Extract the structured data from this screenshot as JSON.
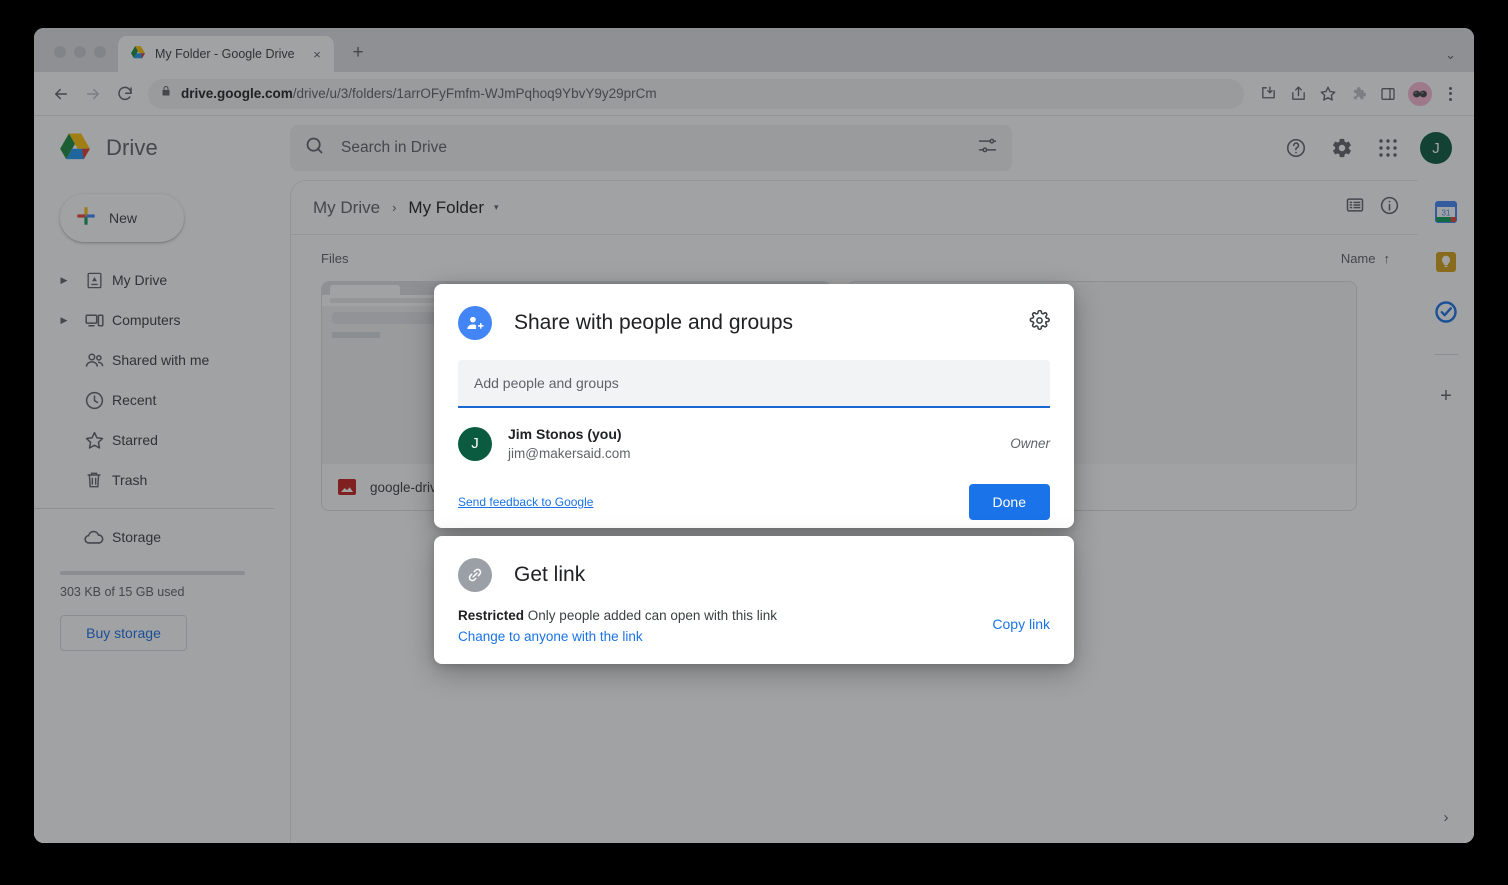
{
  "browser": {
    "tab": {
      "title": "My Folder - Google Drive",
      "favicon": "google-drive-icon",
      "close": "×"
    },
    "new_tab_label": "+",
    "tab_list_chevron": "⌄",
    "nav": {
      "back": "←",
      "forward": "→",
      "reload": "↻"
    },
    "omnibox": {
      "lock_icon": "lock-icon",
      "url_domain": "drive.google.com",
      "url_path": "/drive/u/3/folders/1arrOFyFmfm-WJmPqhoq9YbvY9y29prCm"
    },
    "toolbar_icons": [
      "download-icon",
      "share-icon",
      "bookmark-star-icon",
      "extensions-puzzle-icon",
      "side-panel-icon",
      "profile-avatar-icon",
      "chrome-menu-icon"
    ]
  },
  "drive": {
    "brand": "Drive",
    "search": {
      "placeholder": "Search in Drive",
      "icon": "search-icon",
      "options_icon": "search-options-icon"
    },
    "header_icons": [
      "help-icon",
      "settings-gear-icon",
      "apps-grid-icon"
    ],
    "account_initial": "J",
    "sidebar": {
      "new_button": "New",
      "items": [
        {
          "label": "My Drive",
          "icon": "my-drive-icon",
          "expandable": true
        },
        {
          "label": "Computers",
          "icon": "computers-icon",
          "expandable": true
        },
        {
          "label": "Shared with me",
          "icon": "shared-with-me-icon",
          "expandable": false
        },
        {
          "label": "Recent",
          "icon": "recent-clock-icon",
          "expandable": false
        },
        {
          "label": "Starred",
          "icon": "star-icon",
          "expandable": false
        },
        {
          "label": "Trash",
          "icon": "trash-icon",
          "expandable": false
        },
        {
          "label": "Storage",
          "icon": "cloud-storage-icon",
          "expandable": false
        }
      ],
      "storage_used": "303 KB of 15 GB used",
      "buy_storage": "Buy storage"
    },
    "breadcrumb": {
      "root": "My Drive",
      "separator": "›",
      "current": "My Folder",
      "caret": "▾"
    },
    "view_icons": [
      "list-view-icon",
      "details-info-icon"
    ],
    "files_section": {
      "label": "Files",
      "sort_by": "Name",
      "sort_arrow": "↑",
      "items": [
        {
          "name": "google-drive-",
          "icon": "image-file-icon"
        },
        {
          "name": "",
          "icon": "image-file-icon"
        }
      ]
    },
    "right_rail": {
      "apps": [
        "google-calendar-icon",
        "google-keep-icon",
        "google-tasks-icon"
      ],
      "add_label": "+",
      "expand_label": "›"
    }
  },
  "share_dialog": {
    "icon": "person-add-icon",
    "title": "Share with people and groups",
    "settings_icon": "settings-gear-icon",
    "add_input_placeholder": "Add people and groups",
    "people": [
      {
        "initial": "J",
        "name": "Jim Stonos (you)",
        "email": "jim@makersaid.com",
        "role": "Owner"
      }
    ],
    "feedback_link": "Send feedback to Google",
    "done_button": "Done"
  },
  "get_link_dialog": {
    "icon": "link-icon",
    "title": "Get link",
    "status_label": "Restricted",
    "status_detail": "Only people added can open with this link",
    "change_link": "Change to anyone with the link",
    "copy_link": "Copy link"
  },
  "colors": {
    "accent_blue": "#1a73e8",
    "avatar_green": "#0b5b41",
    "share_icon_blue": "#4285f4",
    "link_icon_gray": "#9aa0a6",
    "file_icon_red": "#c5221f"
  }
}
